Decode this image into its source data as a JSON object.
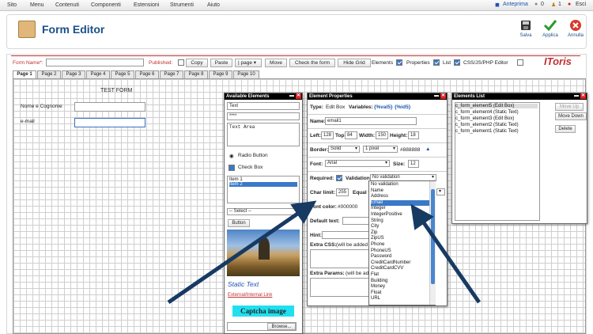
{
  "topbar": {
    "menu": [
      "Sito",
      "Menu",
      "Contenuti",
      "Componenti",
      "Estensioni",
      "Strumenti",
      "Aiuto"
    ],
    "preview": "Anteprima",
    "count_a": "0",
    "count_b": "1",
    "logout": "Esci"
  },
  "header": {
    "title": "Form Editor",
    "save": "Salva",
    "apply": "Applica",
    "cancel": "Annulla"
  },
  "controls": {
    "form_name_label": "Form Name*:",
    "published_label": "Published:",
    "copy": "Copy",
    "paste": "Paste",
    "page_select": "page",
    "move": "Move",
    "check_form": "Check the form",
    "hide_grid": "Hide Grid",
    "elements": "Elements",
    "properties": "Properties",
    "list": "List",
    "css_editor": "CSS/JS/PHP Editor",
    "brand": "IToris"
  },
  "tabs": [
    "Page 1",
    "Page 2",
    "Page 3",
    "Page 4",
    "Page 5",
    "Page 6",
    "Page 7",
    "Page 8",
    "Page 9",
    "Page 10"
  ],
  "form": {
    "title": "TEST FORM",
    "name_label": "Nome e Cognome",
    "email_label": "e-mail"
  },
  "available_elements": {
    "title": "Available Elements",
    "text_value": "Text",
    "password_value": "****",
    "textarea_value": "Text Area",
    "radio_label": "Radio Button",
    "checkbox_label": "Check Box",
    "list_items": [
      "Item 1",
      "Item 2"
    ],
    "select_placeholder": "-- Select --",
    "button_label": "Button",
    "static_text": "Static Text",
    "link_text": "External/Internal Link",
    "captcha_text": "Captcha image",
    "browse_label": "Browse..."
  },
  "element_properties": {
    "title": "Element Properties",
    "type_label": "Type:",
    "type_value": "Edit Box",
    "variables_label": "Variables:",
    "var1": "{%val5}",
    "var2": "{%id5}",
    "name_label": "Name:",
    "name_value": "email1",
    "left_label": "Left:",
    "left_value": "128",
    "top_label": "Top:",
    "top_value": "84",
    "width_label": "Width:",
    "width_value": "150",
    "height_label": "Height:",
    "height_value": "18",
    "border_label": "Border:",
    "border_style": "Solid",
    "border_width": "1 pixel",
    "border_color": "#888888",
    "font_label": "Font:",
    "font_value": "Arial",
    "size_label": "Size:",
    "size_value": "12",
    "required_label": "Required:",
    "validation_label": "Validation:",
    "validation_value": "No validation",
    "char_limit_label": "Char limit:",
    "char_limit_value": "255",
    "equal_label": "Equal to",
    "font_color_label": "Font color:",
    "font_color_value": "#000000",
    "default_text_label": "Default text:",
    "hint_label": "Hint:",
    "extra_css_label": "Extra CSS:",
    "extra_css_note": "(will be added",
    "extra_params_label": "Extra Params:",
    "extra_params_note": "(will be ad"
  },
  "validation_options": [
    "No validation",
    "Name",
    "Address",
    "Email",
    "Integer",
    "IntegerPositive",
    "String",
    "City",
    "Zip",
    "ZipUS",
    "Phone",
    "PhoneUS",
    "Password",
    "CreditCardNumber",
    "CreditCardCVV",
    "Flat",
    "Building",
    "Money",
    "Float",
    "URL"
  ],
  "validation_selected": "Email",
  "elements_list": {
    "title": "Elements List",
    "items": [
      "c_form_element5 (Edit Box)",
      "c_form_element4 (Static Text)",
      "c_form_element3 (Edit Box)",
      "c_form_element2 (Static Text)",
      "c_form_element1 (Static Text)"
    ],
    "move_up": "Move Up",
    "move_down": "Move Down",
    "delete": "Delete"
  },
  "colors": {
    "accent_blue": "#1b4f8a",
    "brand_red": "#c03030",
    "selection": "#3a78c8",
    "arrow": "#173a63"
  }
}
